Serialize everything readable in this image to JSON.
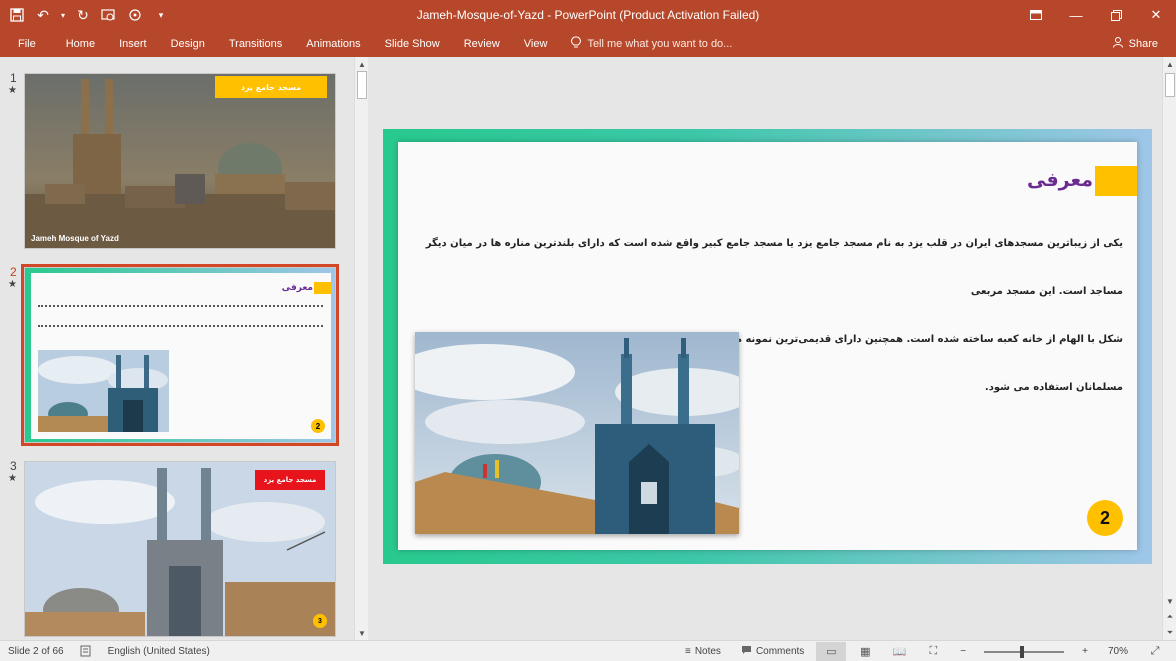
{
  "window": {
    "title": "Jameh-Mosque-of-Yazd - PowerPoint (Product Activation Failed)"
  },
  "ribbon": {
    "tabs": [
      "File",
      "Home",
      "Insert",
      "Design",
      "Transitions",
      "Animations",
      "Slide Show",
      "Review",
      "View"
    ],
    "tell_me": "Tell me what you want to do...",
    "share": "Share"
  },
  "thumbnails": [
    {
      "number": "1",
      "badge_text": "مسجد جامع یزد",
      "caption": "Jameh Mosque of Yazd"
    },
    {
      "number": "2",
      "heading": "معرفی",
      "page_number": "2"
    },
    {
      "number": "3",
      "badge_text": "مسجد جامع یزد",
      "page_number": "3"
    }
  ],
  "slide": {
    "heading": "معرفی",
    "body_line1": "یکی از زیباترین مسجدهای ایران در قلب یزد به نام مسجد جامع یزد یا مسجد جامع کبیر واقع شده است که دارای بلندترین مناره ها در میان دیگر مساجد است. این مسجد مربعی",
    "body_line2": "شکل با الهام از خانه کعبه ساخته شده است. همچنین دارای قدیمی‌ترین نمونه معماری است که به عنوان نماد کیهانی در بین الگوهای معماری مسلمانان استفاده می شود.",
    "page_number": "2"
  },
  "status": {
    "slide_info": "Slide 2 of 66",
    "language": "English (United States)",
    "notes": "Notes",
    "comments": "Comments",
    "zoom": "70%"
  },
  "colors": {
    "accent": "#b7472a",
    "yellow": "#ffc000",
    "heading_purple": "#6a2c91",
    "selection": "#d24726"
  }
}
